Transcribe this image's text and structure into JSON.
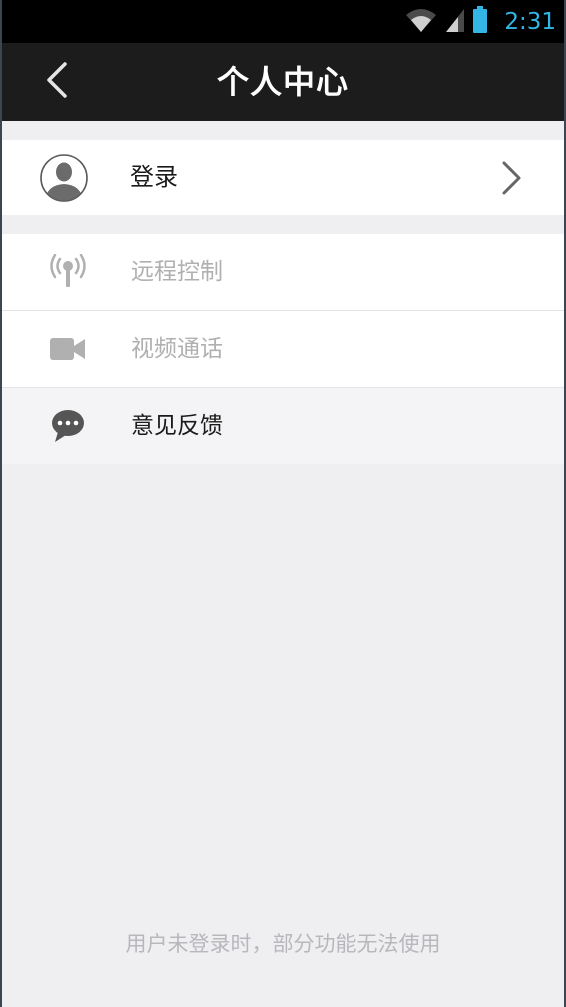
{
  "status_bar": {
    "time": "2:31",
    "icons": [
      "wifi-icon",
      "signal-icon",
      "battery-icon"
    ],
    "time_color": "#33b5e5"
  },
  "nav": {
    "title": "个人中心",
    "back_icon": "chevron-left-icon"
  },
  "login": {
    "label": "登录",
    "avatar_icon": "user-avatar-icon",
    "chevron_icon": "chevron-right-icon"
  },
  "menu": {
    "items": [
      {
        "label": "远程控制",
        "icon": "antenna-icon",
        "enabled": false
      },
      {
        "label": "视频通话",
        "icon": "video-camera-icon",
        "enabled": false
      },
      {
        "label": "意见反馈",
        "icon": "chat-bubble-icon",
        "enabled": true
      }
    ]
  },
  "footer": {
    "note": "用户未登录时，部分功能无法使用"
  },
  "colors": {
    "nav_bg": "#1c1c1c",
    "page_bg": "#efeff2",
    "disabled_text": "#b0b0b0",
    "accent": "#33b5e5"
  }
}
